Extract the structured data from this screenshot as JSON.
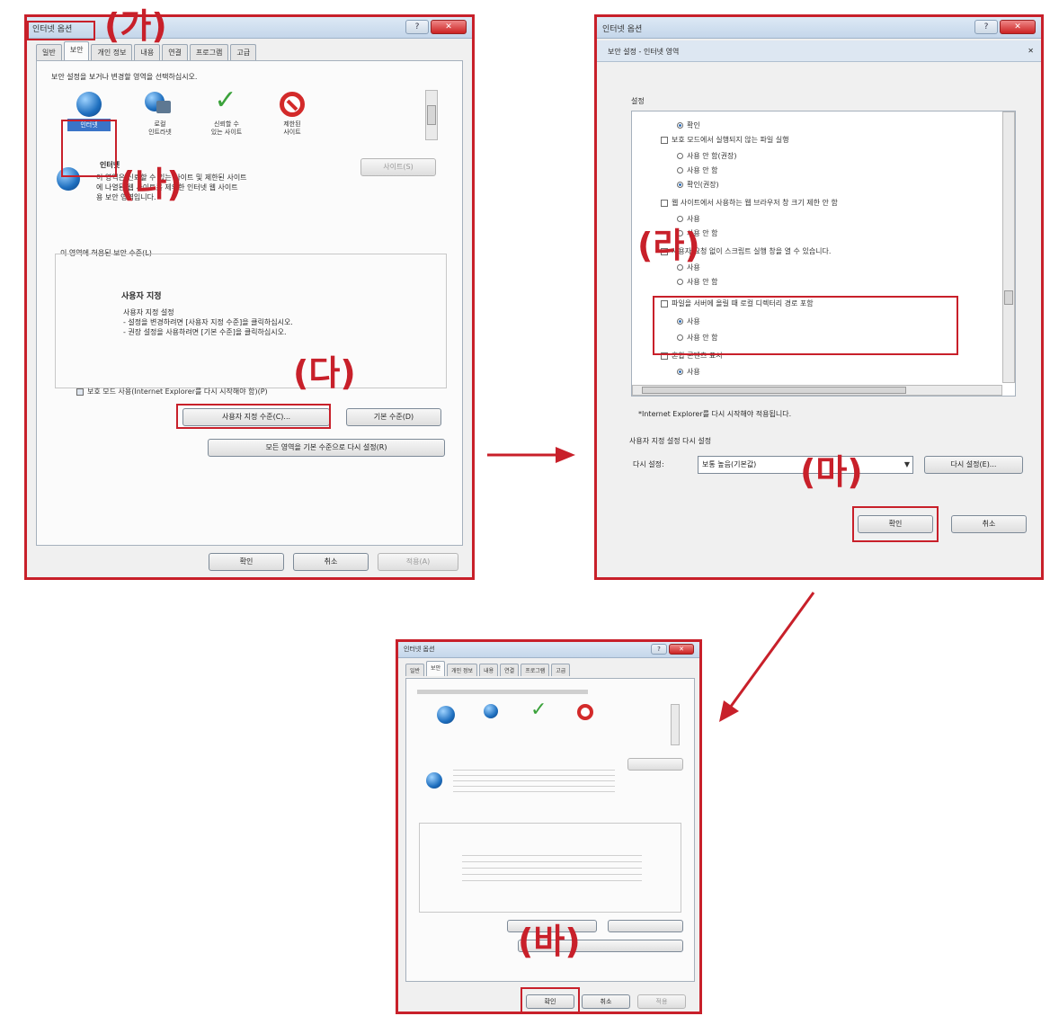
{
  "labels": {
    "ga": "(가)",
    "na": "(나)",
    "da": "(다)",
    "ra": "(라)",
    "ma": "(마)",
    "ba": "(바)"
  },
  "window1": {
    "title": "인터넷 옵션",
    "tabs": [
      "일반",
      "보안",
      "개인 정보",
      "내용",
      "연결",
      "프로그램",
      "고급"
    ],
    "heading": "보안 설정을 보거나 변경할 영역을 선택하십시오.",
    "zones": [
      {
        "label": "인터넷",
        "icon": "globe-icon"
      },
      {
        "label": "로컬\n인트라넷",
        "icon": "intranet-icon"
      },
      {
        "label": "신뢰할 수\n있는 사이트",
        "icon": "check-icon"
      },
      {
        "label": "제한된\n사이트",
        "icon": "blocked-icon"
      }
    ],
    "zone_name": "인터넷",
    "zone_desc": "이 영역은 신뢰할 수 있는 사이트 및 제한된 사이트\n에 나열된 웹 사이트를 제외한 인터넷 웹 사이트\n용 보안 영역입니다.",
    "sites_button": "사이트(S)",
    "level_group": "이 영역에 허용된 보안 수준(L)",
    "custom_title": "사용자 지정",
    "custom_desc": "사용자 지정 설정\n- 설정을 변경하려면 [사용자 지정 수준]을 클릭하십시오.\n- 권장 설정을 사용하려면 [기본 수준]을 클릭하십시오.",
    "protected_mode": "보호 모드 사용(Internet Explorer를 다시 시작해야 함)(P)",
    "custom_level_button": "사용자 지정 수준(C)...",
    "default_level_button": "기본 수준(D)",
    "reset_all_button": "모든 영역을 기본 수준으로 다시 설정(R)",
    "ok": "확인",
    "cancel": "취소",
    "apply": "적용(A)"
  },
  "window2": {
    "title": "인터넷 옵션",
    "subtitle": "보안 설정 - 인터넷 영역",
    "settings_label": "설정",
    "options": [
      {
        "type": "radio",
        "text": "확인",
        "checked": true
      },
      {
        "type": "check",
        "text": "보호 모드에서 실행되지 않는 파일 실행"
      },
      {
        "type": "radio",
        "text": "사용 안 함(권장)"
      },
      {
        "type": "radio",
        "text": "사용 안 함"
      },
      {
        "type": "radio",
        "text": "확인(권장)",
        "checked": true
      },
      {
        "type": "check",
        "text": "웹 사이트에서 사용하는 웹 브라우저 창 크기 제한 안 함"
      },
      {
        "type": "radio",
        "text": "사용"
      },
      {
        "type": "radio",
        "text": "사용 안 함"
      },
      {
        "type": "check",
        "text": "사용자 요청 없이 스크립트 실행 창을 열 수 있습니다."
      },
      {
        "type": "radio",
        "text": "사용"
      },
      {
        "type": "radio",
        "text": "사용 안 함"
      },
      {
        "type": "check",
        "text": "파일을 서버에 올릴 때 로컬 디렉터리 경로 포함"
      },
      {
        "type": "radio",
        "text": "사용",
        "checked": true
      },
      {
        "type": "radio",
        "text": "사용 안 함"
      },
      {
        "type": "check",
        "text": "혼합 콘텐츠 표시"
      },
      {
        "type": "radio",
        "text": "사용",
        "checked": true
      }
    ],
    "note": "*Internet Explorer를 다시 시작해야 적용됩니다.",
    "reset_group": "사용자 지정 설정 다시 설정",
    "reset_to_label": "다시 설정:",
    "reset_select_value": "보통 높음(기본값)",
    "reset_button": "다시 설정(E)...",
    "ok": "확인",
    "cancel": "취소"
  },
  "window3": {
    "title": "인터넷 옵션",
    "tabs": [
      "일반",
      "보안",
      "개인 정보",
      "내용",
      "연결",
      "프로그램",
      "고급"
    ],
    "ok": "확인",
    "cancel": "취소",
    "apply": "적용"
  }
}
